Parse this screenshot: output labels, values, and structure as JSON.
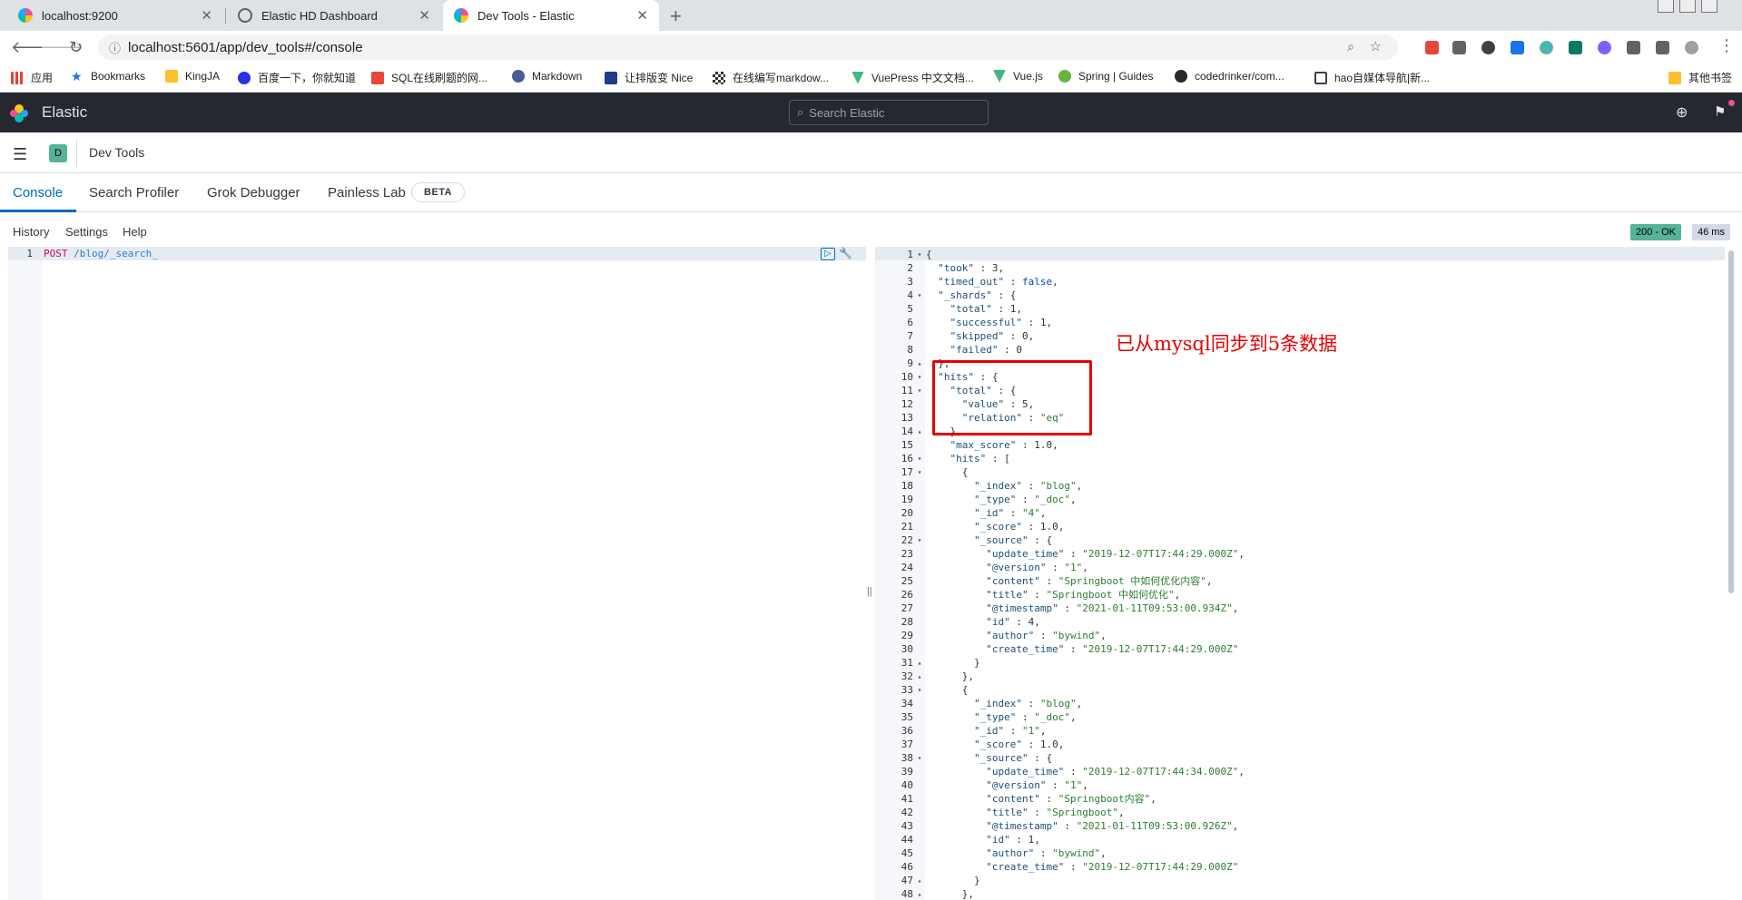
{
  "browser": {
    "tabs": [
      {
        "title": "localhost:9200",
        "icon": "elasticsearch-icon",
        "active": false
      },
      {
        "title": "Elastic HD Dashboard",
        "icon": "globe-icon",
        "active": false
      },
      {
        "title": "Dev Tools - Elastic",
        "icon": "elastic-icon",
        "active": true
      }
    ],
    "url": "localhost:5601/app/dev_tools#/console",
    "bookmarks": [
      {
        "label": "应用",
        "icon": "apps-grid-icon"
      },
      {
        "label": "Bookmarks",
        "icon": "star-icon"
      },
      {
        "label": "KingJA",
        "icon": "folder-icon"
      },
      {
        "label": "百度一下，你就知道",
        "icon": "baidu-icon"
      },
      {
        "label": "SQL在线刷题的网...",
        "icon": "c-icon"
      },
      {
        "label": "Markdown",
        "icon": "markdown-icon"
      },
      {
        "label": "让排版变 Nice",
        "icon": "nice-icon"
      },
      {
        "label": "在线编写markdow...",
        "icon": "qr-icon"
      },
      {
        "label": "VuePress 中文文档...",
        "icon": "vue-icon"
      },
      {
        "label": "Vue.js",
        "icon": "vue-icon"
      },
      {
        "label": "Spring | Guides",
        "icon": "spring-icon"
      },
      {
        "label": "codedrinker/com...",
        "icon": "github-icon"
      },
      {
        "label": "hao自媒体导航|新...",
        "icon": "book-icon"
      },
      {
        "label": "其他书签",
        "icon": "folder-icon"
      }
    ]
  },
  "kibana": {
    "brand": "Elastic",
    "search_placeholder": "Search Elastic",
    "app_badge": "D",
    "breadcrumb": "Dev Tools",
    "tabs": [
      "Console",
      "Search Profiler",
      "Grok Debugger",
      "Painless Lab"
    ],
    "beta_label": "BETA",
    "console_links": [
      "History",
      "Settings",
      "Help"
    ],
    "status": "200 - OK",
    "timing": "46 ms"
  },
  "request": {
    "line_number": "1",
    "method": "POST",
    "path": "/blog/_search_"
  },
  "response_lines": [
    "{",
    "  \"took\" : 3,",
    "  \"timed_out\" : false,",
    "  \"_shards\" : {",
    "    \"total\" : 1,",
    "    \"successful\" : 1,",
    "    \"skipped\" : 0,",
    "    \"failed\" : 0",
    "  },",
    "  \"hits\" : {",
    "    \"total\" : {",
    "      \"value\" : 5,",
    "      \"relation\" : \"eq\"",
    "    },",
    "    \"max_score\" : 1.0,",
    "    \"hits\" : [",
    "      {",
    "        \"_index\" : \"blog\",",
    "        \"_type\" : \"_doc\",",
    "        \"_id\" : \"4\",",
    "        \"_score\" : 1.0,",
    "        \"_source\" : {",
    "          \"update_time\" : \"2019-12-07T17:44:29.000Z\",",
    "          \"@version\" : \"1\",",
    "          \"content\" : \"Springboot 中如何优化内容\",",
    "          \"title\" : \"Springboot 中如何优化\",",
    "          \"@timestamp\" : \"2021-01-11T09:53:00.934Z\",",
    "          \"id\" : 4,",
    "          \"author\" : \"bywind\",",
    "          \"create_time\" : \"2019-12-07T17:44:29.000Z\"",
    "        }",
    "      },",
    "      {",
    "        \"_index\" : \"blog\",",
    "        \"_type\" : \"_doc\",",
    "        \"_id\" : \"1\",",
    "        \"_score\" : 1.0,",
    "        \"_source\" : {",
    "          \"update_time\" : \"2019-12-07T17:44:34.000Z\",",
    "          \"@version\" : \"1\",",
    "          \"content\" : \"Springboot内容\",",
    "          \"title\" : \"Springboot\",",
    "          \"@timestamp\" : \"2021-01-11T09:53:00.926Z\",",
    "          \"id\" : 1,",
    "          \"author\" : \"bywind\",",
    "          \"create_time\" : \"2019-12-07T17:44:29.000Z\"",
    "        }",
    "      },"
  ],
  "fold_open_lines": [
    1,
    4,
    10,
    11,
    16,
    17,
    22,
    33,
    38
  ],
  "fold_close_lines": [
    9,
    14,
    31,
    32,
    47,
    48
  ],
  "annotation": {
    "text": "已从mysql同步到5条数据",
    "color": "#e60000"
  }
}
